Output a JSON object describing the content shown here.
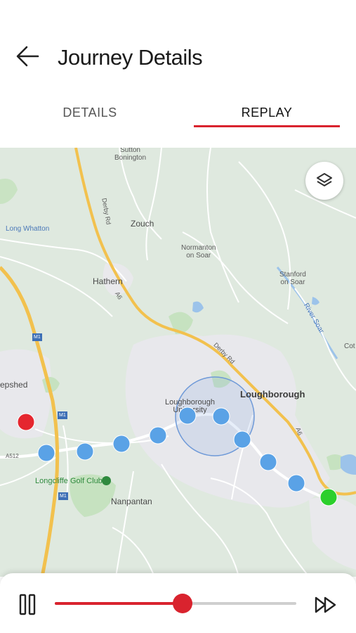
{
  "header": {
    "title": "Journey Details",
    "back_icon": "arrow-left-icon"
  },
  "tabs": [
    {
      "label": "DETAILS",
      "active": false
    },
    {
      "label": "REPLAY",
      "active": true
    }
  ],
  "map": {
    "layers_icon": "layers-icon",
    "places": {
      "sutton_bonington": "Sutton\nBonington",
      "long_whatton": "Long Whatton",
      "zouch": "Zouch",
      "normanton": "Normanton\non Soar",
      "hathern": "Hathern",
      "stanford": "Stanford\non Soar",
      "river_soar": "River Soar",
      "cotes": "Cot",
      "shepshed": "epshed",
      "loughborough": "Loughborough",
      "loughborough_uni": "Loughborough\nUniversity",
      "longcliffe": "Longcliffe Golf Club",
      "nanpantan": "Nanpantan",
      "derby_rd_1": "Derby Rd",
      "derby_rd_2": "Derby Rd",
      "m1_a": "M1",
      "m1_b": "M1",
      "m1_c": "M1",
      "a6_a": "A6",
      "a6_b": "A6",
      "a512": "A512"
    },
    "markers": {
      "start_color": "#e5262f",
      "end_color": "#2ccf2c",
      "point_color": "#5aa2e6"
    }
  },
  "player": {
    "pause_icon": "pause-icon",
    "fast_forward_icon": "fast-forward-icon",
    "progress": 0.53,
    "accent": "#d9232e"
  }
}
